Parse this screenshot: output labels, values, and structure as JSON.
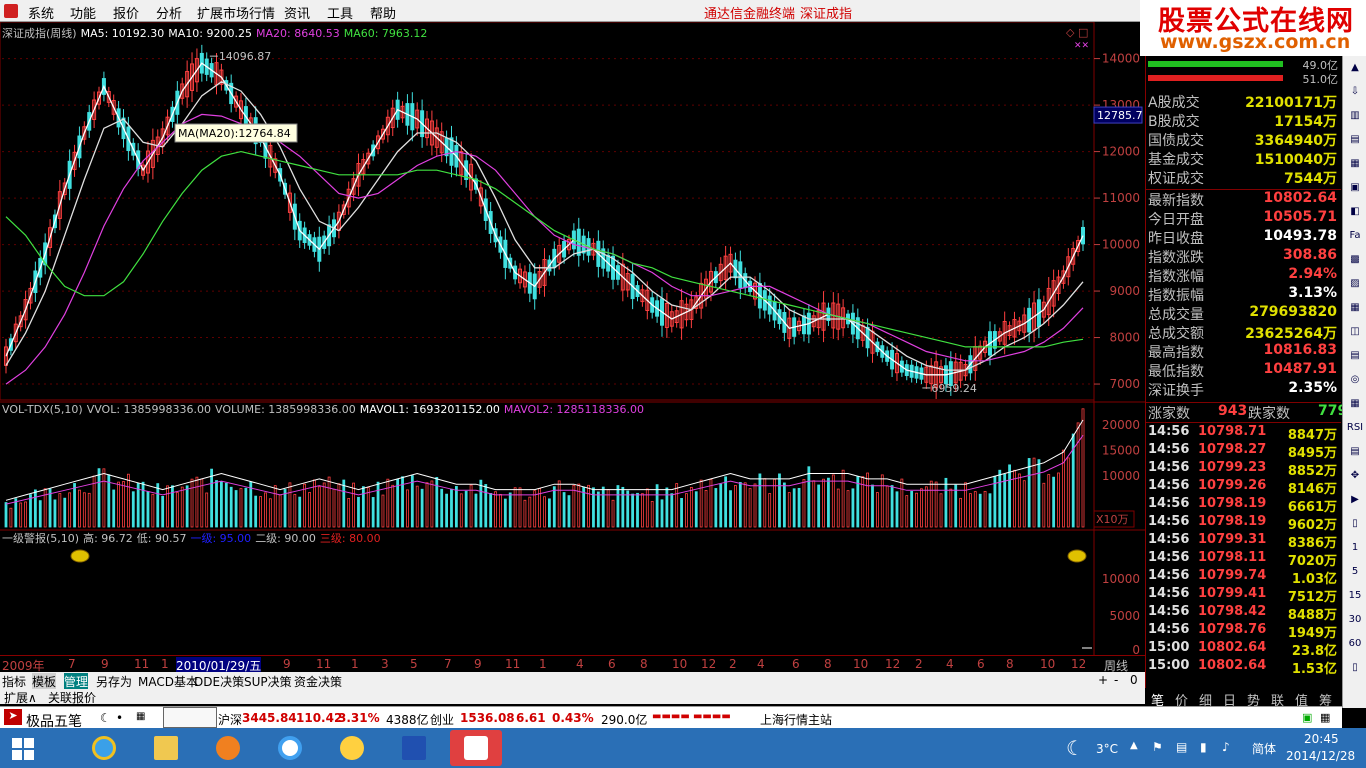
{
  "menu": {
    "items": [
      "系统",
      "功能",
      "报价",
      "分析",
      "扩展市场行情",
      "资讯",
      "工具",
      "帮助"
    ],
    "promo_left": "通达信金融终端",
    "promo_right": "深证成指"
  },
  "brand": {
    "cn": "股票公式在线网",
    "url": "www.gszx.com.cn"
  },
  "legends": {
    "main": [
      {
        "text": "深证成指(周线)",
        "color": "#c0c0c0"
      },
      {
        "text": "MA5: 10192.30",
        "color": "#ffffff"
      },
      {
        "text": "MA10: 9200.25",
        "color": "#ffffff"
      },
      {
        "text": "MA20: 8640.53",
        "color": "#e040e0"
      },
      {
        "text": "MA60: 7963.12",
        "color": "#40e040"
      }
    ],
    "vol": [
      {
        "text": "VOL-TDX(5,10)",
        "color": "#c0c0c0"
      },
      {
        "text": "VVOL: 1385998336.00",
        "color": "#c0c0c0"
      },
      {
        "text": "VOLUME: 1385998336.00",
        "color": "#c0c0c0"
      },
      {
        "text": "MAVOL1: 1693201152.00",
        "color": "#ffffff"
      },
      {
        "text": "MAVOL2: 1285118336.00",
        "color": "#e040e0"
      }
    ],
    "alert": [
      {
        "text": "一级警报(5,10)",
        "color": "#c0c0c0"
      },
      {
        "text": "高: 96.72",
        "color": "#c0c0c0"
      },
      {
        "text": "低: 90.57",
        "color": "#c0c0c0"
      },
      {
        "text": "一级: 95.00",
        "color": "#2020ff"
      },
      {
        "text": "二级: 90.00",
        "color": "#c0c0c0"
      },
      {
        "text": "三级: 80.00",
        "color": "#e02020"
      }
    ]
  },
  "chart_data": {
    "type": "line",
    "title": "深证成指(周线)",
    "price_axis": {
      "ticks": [
        "14000",
        "13000",
        "12000",
        "11000",
        "10000",
        "9000",
        "8000",
        "7000"
      ],
      "ylim": [
        6700,
        14400
      ]
    },
    "vol_axis": {
      "ticks": [
        "20000",
        "15000",
        "10000"
      ],
      "unit": "X10万"
    },
    "alert_axis": {
      "ticks": [
        "10000",
        "5000",
        "0"
      ]
    },
    "annotations": {
      "high": "14096.87",
      "low": "6959.24",
      "tooltip": "MA(MA20):12764.84",
      "price_marker": "12785.7"
    },
    "x_ticks": [
      "2009年",
      "7",
      "9",
      "11",
      "1",
      "2010/01/29/五",
      "9",
      "11",
      "1",
      "3",
      "5",
      "7",
      "9",
      "11",
      "1",
      "4",
      "6",
      "8",
      "10",
      "12",
      "2",
      "4",
      "6",
      "8",
      "10",
      "12",
      "2",
      "4",
      "6",
      "8",
      "10",
      "12"
    ],
    "period": "周线",
    "series": [
      {
        "name": "MA5",
        "color": "#ffffff",
        "values": [
          7600,
          8600,
          9800,
          11200,
          12400,
          13400,
          12500,
          11600,
          12300,
          13300,
          13900,
          13600,
          12900,
          12300,
          11500,
          10300,
          9900,
          10500,
          11500,
          12200,
          12900,
          12700,
          12300,
          11900,
          11300,
          10200,
          9400,
          9100,
          9700,
          10100,
          9900,
          9500,
          9100,
          8700,
          8400,
          8600,
          9200,
          9600,
          9100,
          8700,
          8200,
          8300,
          8500,
          8400,
          8000,
          7600,
          7300,
          7200,
          7200,
          7300,
          7800,
          8100,
          8300,
          8600,
          9300,
          10192
        ]
      },
      {
        "name": "MA10",
        "color": "#e0e0e0",
        "values": [
          7400,
          8100,
          9000,
          10200,
          11400,
          12500,
          12700,
          12200,
          12100,
          12600,
          13200,
          13500,
          13300,
          12800,
          12100,
          11200,
          10500,
          10300,
          10800,
          11400,
          12000,
          12400,
          12400,
          12200,
          11800,
          11000,
          10100,
          9500,
          9500,
          9800,
          9900,
          9700,
          9400,
          9000,
          8700,
          8600,
          8900,
          9300,
          9300,
          9000,
          8600,
          8400,
          8400,
          8400,
          8200,
          7900,
          7600,
          7400,
          7300,
          7300,
          7500,
          7800,
          8000,
          8300,
          8700,
          9200
        ]
      },
      {
        "name": "MA20",
        "color": "#e040e0",
        "values": [
          7000,
          7300,
          7800,
          8500,
          9400,
          10400,
          11200,
          11800,
          12200,
          12600,
          12800,
          12764,
          12600,
          12400,
          12200,
          11900,
          11500,
          11100,
          11000,
          11100,
          11400,
          11700,
          11900,
          12000,
          11900,
          11600,
          11100,
          10600,
          10200,
          10000,
          9900,
          9800,
          9600,
          9400,
          9100,
          8900,
          8900,
          9000,
          9100,
          9100,
          8900,
          8700,
          8500,
          8400,
          8300,
          8100,
          7900,
          7700,
          7600,
          7500,
          7500,
          7600,
          7700,
          7900,
          8200,
          8640
        ]
      },
      {
        "name": "MA60",
        "color": "#40e040",
        "values": [
          10600,
          10200,
          9600,
          9100,
          8900,
          8900,
          9200,
          9800,
          10500,
          11100,
          11600,
          11900,
          12000,
          11900,
          11800,
          11700,
          11600,
          11500,
          11500,
          11500,
          11500,
          11600,
          11600,
          11500,
          11400,
          11200,
          10900,
          10600,
          10300,
          10100,
          9900,
          9800,
          9600,
          9500,
          9300,
          9200,
          9100,
          9000,
          8900,
          8800,
          8700,
          8600,
          8500,
          8400,
          8300,
          8200,
          8100,
          8000,
          7900,
          7800,
          7800,
          7800,
          7800,
          7800,
          7900,
          7963
        ]
      }
    ],
    "volume": [
      5,
      6,
      7,
      8,
      9,
      10,
      9,
      8,
      7,
      8,
      9,
      10,
      9,
      8,
      7,
      8,
      9,
      8,
      7,
      8,
      9,
      10,
      9,
      8,
      8,
      7,
      7,
      7,
      8,
      8,
      7,
      7,
      7,
      7,
      7,
      8,
      9,
      10,
      9,
      9,
      9,
      10,
      10,
      10,
      9,
      9,
      8,
      8,
      8,
      8,
      9,
      10,
      11,
      12,
      14,
      20
    ],
    "alert_markers": [
      "80",
      "1077"
    ]
  },
  "panel": {
    "bars": [
      {
        "val": "49.0亿",
        "color": "#20c020"
      },
      {
        "val": "51.0亿",
        "color": "#e02020"
      }
    ],
    "index_marker": "12785.7",
    "rows": [
      {
        "label": "A股成交",
        "value": "22100171万",
        "color": "#e0e000"
      },
      {
        "label": "B股成交",
        "value": "17154万",
        "color": "#e0e000"
      },
      {
        "label": "国债成交",
        "value": "3364940万",
        "color": "#e0e000"
      },
      {
        "label": "基金成交",
        "value": "1510040万",
        "color": "#e0e000"
      },
      {
        "label": "权证成交",
        "value": "7544万",
        "color": "#e0e000"
      },
      {
        "label": "最新指数",
        "value": "10802.64",
        "color": "#ff4040"
      },
      {
        "label": "今日开盘",
        "value": "10505.71",
        "color": "#ff4040"
      },
      {
        "label": "昨日收盘",
        "value": "10493.78",
        "color": "#ffffff"
      },
      {
        "label": "指数涨跌",
        "value": "308.86",
        "color": "#ff4040"
      },
      {
        "label": "指数涨幅",
        "value": "2.94%",
        "color": "#ff4040"
      },
      {
        "label": "指数振幅",
        "value": "3.13%",
        "color": "#ffffff"
      },
      {
        "label": "总成交量",
        "value": "279693820",
        "color": "#e0e000"
      },
      {
        "label": "总成交额",
        "value": "23625264万",
        "color": "#e0e000"
      },
      {
        "label": "最高指数",
        "value": "10816.83",
        "color": "#ff4040"
      },
      {
        "label": "最低指数",
        "value": "10487.91",
        "color": "#ff4040"
      },
      {
        "label": "深证换手",
        "value": "2.35%",
        "color": "#ffffff"
      }
    ],
    "updown": {
      "up_label": "涨家数",
      "up": "943",
      "down_label": "跌家数",
      "down": "779"
    },
    "ticks": [
      {
        "t": "14:56",
        "p": "10798.71",
        "v": "8847万"
      },
      {
        "t": "14:56",
        "p": "10798.27",
        "v": "8495万"
      },
      {
        "t": "14:56",
        "p": "10799.23",
        "v": "8852万"
      },
      {
        "t": "14:56",
        "p": "10799.26",
        "v": "8146万"
      },
      {
        "t": "14:56",
        "p": "10798.19",
        "v": "6661万"
      },
      {
        "t": "14:56",
        "p": "10798.19",
        "v": "9602万"
      },
      {
        "t": "14:56",
        "p": "10799.31",
        "v": "8386万"
      },
      {
        "t": "14:56",
        "p": "10798.11",
        "v": "7020万"
      },
      {
        "t": "14:56",
        "p": "10799.74",
        "v": "1.03亿"
      },
      {
        "t": "14:56",
        "p": "10799.41",
        "v": "7512万"
      },
      {
        "t": "14:56",
        "p": "10798.42",
        "v": "8488万"
      },
      {
        "t": "14:56",
        "p": "10798.76",
        "v": "1949万"
      },
      {
        "t": "15:00",
        "p": "10802.64",
        "v": "23.8亿"
      },
      {
        "t": "15:00",
        "p": "10802.64",
        "v": "1.53亿"
      }
    ],
    "tabs": [
      "笔",
      "价",
      "细",
      "日",
      "势",
      "联",
      "值",
      "筹"
    ]
  },
  "tabbar": {
    "items": [
      "指标",
      "模板",
      "管理",
      "另存为",
      "MACD基本",
      "DDE决策",
      "SUP决策",
      "资金决策"
    ],
    "period_label": "周线",
    "ctrl": [
      "+",
      "-",
      "0"
    ]
  },
  "tabbar2": {
    "items": [
      "扩展∧",
      "关联报价"
    ]
  },
  "status": {
    "ime": "极品五笔",
    "sh_label": "沪深",
    "sh_val": "3445.84",
    "sh_chg": "110.42",
    "sh_pct": "3.31%",
    "sh_amt": "4388亿",
    "cy_label": "创业",
    "cy_val": "1536.08",
    "cy_chg": "6.61",
    "cy_pct": "0.43%",
    "cy_amt": "290.0亿",
    "station": "上海行情主站"
  },
  "taskbar": {
    "weather": "3°C",
    "lang": "简体",
    "time": "20:45",
    "date": "2014/12/28"
  }
}
